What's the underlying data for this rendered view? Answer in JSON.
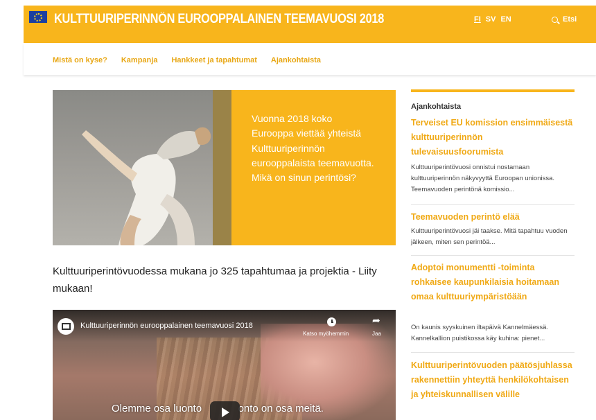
{
  "header": {
    "title": "KULTTUURIPERINNÖN EUROOPPALAINEN TEEMAVUOSI 2018",
    "languages": [
      "FI",
      "SV",
      "EN"
    ],
    "active_language": "FI",
    "search_label": "Etsi",
    "accent_color": "#f8b51c"
  },
  "nav": {
    "items": [
      "Mistä on kyse?",
      "Kampanja",
      "Hankkeet ja tapahtumat",
      "Ajankohtaista"
    ]
  },
  "hero": {
    "text": "Vuonna 2018 koko Eurooppa viettää yhteistä Kulttuuriperinnön eurooppalaista teemavuotta. Mikä on sinun perintösi?"
  },
  "main": {
    "headline": "Kulttuuriperintövuodessa mukana jo 325 tapahtumaa ja projektia - Liity mukaan!"
  },
  "video": {
    "title": "Kulttuuriperinnön eurooppalainen teemavuosi 2018",
    "watch_later_label": "Katso myöhemmin",
    "share_label": "Jaa",
    "subtitle": "Olemme osa luonto       onto on osa meitä."
  },
  "sidebar": {
    "heading": "Ajankohtaista",
    "news": [
      {
        "title": "Terveiset EU komission ensimmäisestä kulttuuriperinnön tulevaisuusfoorumista",
        "excerpt": "Kulttuuriperintövuosi onnistui nostamaan kulttuuriperinnön näkyvyyttä Euroopan unionissa. Teemavuoden perintönä komissio..."
      },
      {
        "title": "Teemavuoden perintö elää",
        "excerpt": "Kulttuuriperintövuosi jäi taakse. Mitä tapahtuu vuoden jälkeen, miten sen perintöä..."
      },
      {
        "title": "Adoptoi monumentti -toiminta rohkaisee kaupunkilaisia hoitamaan omaa kulttuuriympäristöään",
        "excerpt": "On kaunis syyskuinen iltapäivä Kannelmäessä. Kannelkallion puistikossa käy kuhina: pienet..."
      },
      {
        "title": "Kulttuuriperintövuoden päätösjuhlassa rakennettiin yhteyttä henkilökohtaisen ja yhteiskunnallisen välille",
        "excerpt": ""
      }
    ]
  }
}
